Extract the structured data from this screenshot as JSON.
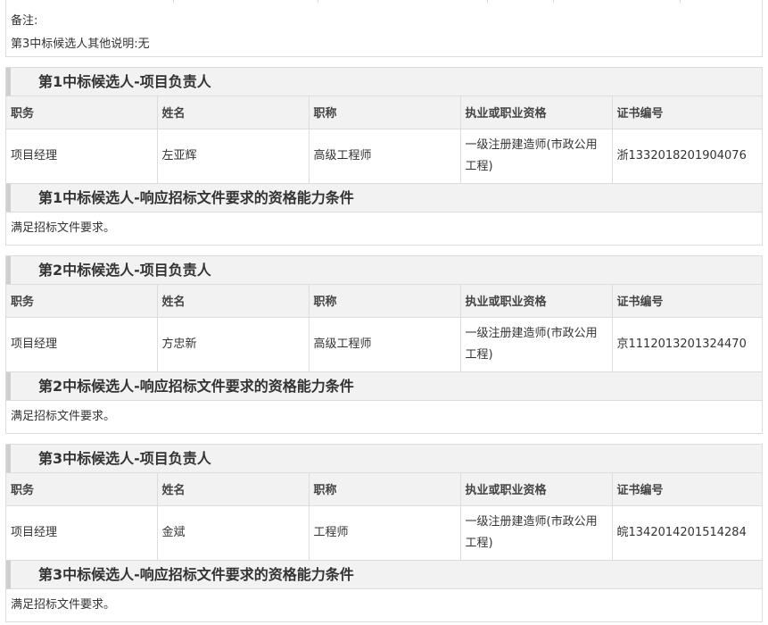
{
  "remark": {
    "label": "备注:",
    "text": "第3中标候选人其他说明:无"
  },
  "table_headers": [
    "职务",
    "姓名",
    "职称",
    "执业或职业资格",
    "证书编号"
  ],
  "candidates": [
    {
      "leader_title": "第1中标候选人-项目负责人",
      "row": [
        "项目经理",
        "左亚辉",
        "高级工程师",
        "一级注册建造师(市政公用工程)",
        "浙1332018201904076"
      ],
      "req_title": "第1中标候选人-响应招标文件要求的资格能力条件",
      "req_text": "满足招标文件要求。"
    },
    {
      "leader_title": "第2中标候选人-项目负责人",
      "row": [
        "项目经理",
        "方忠新",
        "高级工程师",
        "一级注册建造师(市政公用工程)",
        "京1112013201324470"
      ],
      "req_title": "第2中标候选人-响应招标文件要求的资格能力条件",
      "req_text": "满足招标文件要求。"
    },
    {
      "leader_title": "第3中标候选人-项目负责人",
      "row": [
        "项目经理",
        "金斌",
        "工程师",
        "一级注册建造师(市政公用工程)",
        "皖1342014201514284"
      ],
      "req_title": "第3中标候选人-响应招标文件要求的资格能力条件",
      "req_text": "满足招标文件要求。"
    }
  ]
}
